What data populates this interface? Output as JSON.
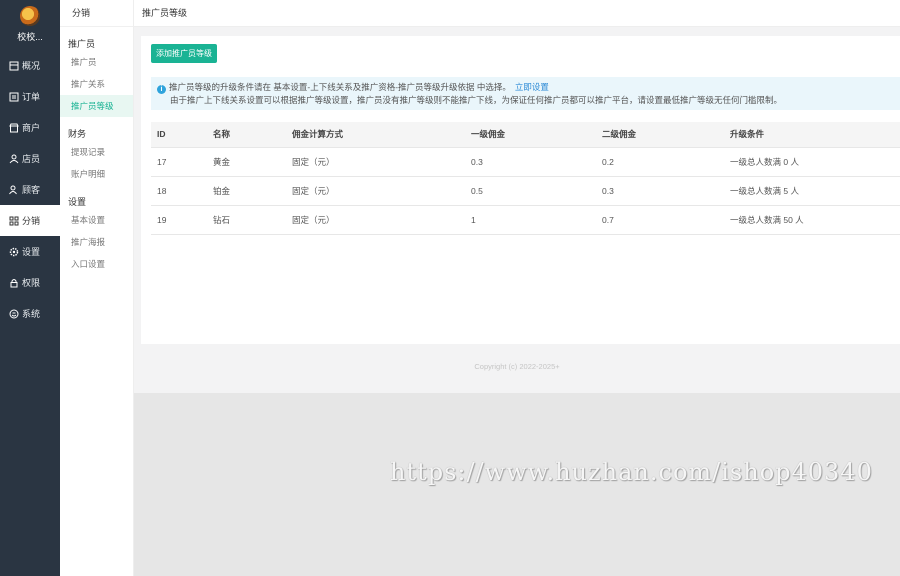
{
  "sidebar": {
    "shop_name": "校校...",
    "items": [
      {
        "label": "概况",
        "icon": "dashboard-icon"
      },
      {
        "label": "订单",
        "icon": "order-icon"
      },
      {
        "label": "商户",
        "icon": "merchant-icon"
      },
      {
        "label": "店员",
        "icon": "staff-icon"
      },
      {
        "label": "顾客",
        "icon": "customer-icon"
      },
      {
        "label": "分销",
        "icon": "distribution-icon"
      },
      {
        "label": "设置",
        "icon": "gear-icon"
      },
      {
        "label": "权限",
        "icon": "lock-icon"
      },
      {
        "label": "系统",
        "icon": "system-icon"
      }
    ]
  },
  "subnav": {
    "title": "分销",
    "groups": [
      {
        "title": "推广员",
        "items": [
          "推广员",
          "推广关系",
          "推广员等级"
        ]
      },
      {
        "title": "财务",
        "items": [
          "提现记录",
          "账户明细"
        ]
      },
      {
        "title": "设置",
        "items": [
          "基本设置",
          "推广海报",
          "入口设置"
        ]
      }
    ]
  },
  "page_title": "推广员等级",
  "add_button": "添加推广员等级",
  "alert": {
    "line1": "推广员等级的升级条件请在 基本设置-上下线关系及推广资格-推广员等级升级依据 中选择。",
    "link": "立即设置",
    "line2": "由于推广上下线关系设置可以根据推广等级设置，推广员没有推广等级则不能推广下线，为保证任何推广员都可以推广平台，请设置最低推广等级无任何门槛限制。"
  },
  "table": {
    "headers": [
      "ID",
      "名称",
      "佣金计算方式",
      "一级佣金",
      "二级佣金",
      "升级条件"
    ],
    "rows": [
      [
        "17",
        "黄金",
        "固定（元）",
        "0.3",
        "0.2",
        "一级总人数满 0 人"
      ],
      [
        "18",
        "铂金",
        "固定（元）",
        "0.5",
        "0.3",
        "一级总人数满 5 人"
      ],
      [
        "19",
        "钻石",
        "固定（元）",
        "1",
        "0.7",
        "一级总人数满 50 人"
      ]
    ]
  },
  "copyright": "Copyright (c) 2022-2025+",
  "watermark": "https://www.huzhan.com/ishop40340",
  "colors": {
    "sidebar_bg": "#2a3542",
    "accent": "#1ab394",
    "link": "#2e8bd6"
  }
}
